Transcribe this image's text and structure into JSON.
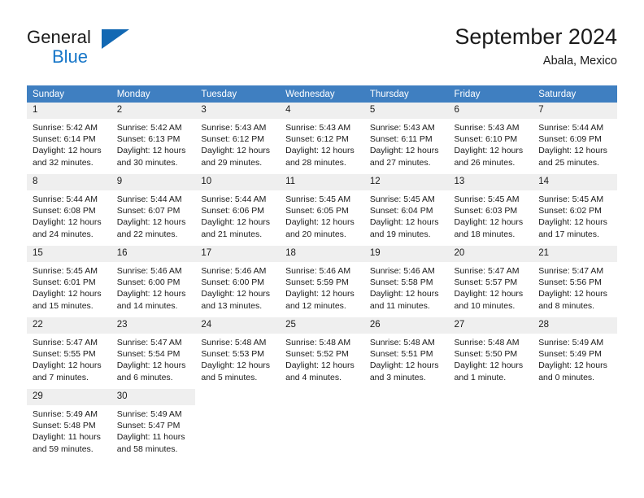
{
  "brand": {
    "name_part1": "General",
    "name_part2": "Blue",
    "logo_icon": "triangle-flag-icon"
  },
  "header": {
    "title": "September 2024",
    "subtitle": "Abala, Mexico"
  },
  "colors": {
    "header_blue": "#3f7fc1",
    "week_separator_blue": "#1b66ac",
    "daynum_band": "#efefef",
    "brand_blue": "#1676c8"
  },
  "calendar": {
    "weekday_headers": [
      "Sunday",
      "Monday",
      "Tuesday",
      "Wednesday",
      "Thursday",
      "Friday",
      "Saturday"
    ],
    "weeks": [
      [
        {
          "day": "1",
          "sunrise": "Sunrise: 5:42 AM",
          "sunset": "Sunset: 6:14 PM",
          "daylight1": "Daylight: 12 hours",
          "daylight2": "and 32 minutes."
        },
        {
          "day": "2",
          "sunrise": "Sunrise: 5:42 AM",
          "sunset": "Sunset: 6:13 PM",
          "daylight1": "Daylight: 12 hours",
          "daylight2": "and 30 minutes."
        },
        {
          "day": "3",
          "sunrise": "Sunrise: 5:43 AM",
          "sunset": "Sunset: 6:12 PM",
          "daylight1": "Daylight: 12 hours",
          "daylight2": "and 29 minutes."
        },
        {
          "day": "4",
          "sunrise": "Sunrise: 5:43 AM",
          "sunset": "Sunset: 6:12 PM",
          "daylight1": "Daylight: 12 hours",
          "daylight2": "and 28 minutes."
        },
        {
          "day": "5",
          "sunrise": "Sunrise: 5:43 AM",
          "sunset": "Sunset: 6:11 PM",
          "daylight1": "Daylight: 12 hours",
          "daylight2": "and 27 minutes."
        },
        {
          "day": "6",
          "sunrise": "Sunrise: 5:43 AM",
          "sunset": "Sunset: 6:10 PM",
          "daylight1": "Daylight: 12 hours",
          "daylight2": "and 26 minutes."
        },
        {
          "day": "7",
          "sunrise": "Sunrise: 5:44 AM",
          "sunset": "Sunset: 6:09 PM",
          "daylight1": "Daylight: 12 hours",
          "daylight2": "and 25 minutes."
        }
      ],
      [
        {
          "day": "8",
          "sunrise": "Sunrise: 5:44 AM",
          "sunset": "Sunset: 6:08 PM",
          "daylight1": "Daylight: 12 hours",
          "daylight2": "and 24 minutes."
        },
        {
          "day": "9",
          "sunrise": "Sunrise: 5:44 AM",
          "sunset": "Sunset: 6:07 PM",
          "daylight1": "Daylight: 12 hours",
          "daylight2": "and 22 minutes."
        },
        {
          "day": "10",
          "sunrise": "Sunrise: 5:44 AM",
          "sunset": "Sunset: 6:06 PM",
          "daylight1": "Daylight: 12 hours",
          "daylight2": "and 21 minutes."
        },
        {
          "day": "11",
          "sunrise": "Sunrise: 5:45 AM",
          "sunset": "Sunset: 6:05 PM",
          "daylight1": "Daylight: 12 hours",
          "daylight2": "and 20 minutes."
        },
        {
          "day": "12",
          "sunrise": "Sunrise: 5:45 AM",
          "sunset": "Sunset: 6:04 PM",
          "daylight1": "Daylight: 12 hours",
          "daylight2": "and 19 minutes."
        },
        {
          "day": "13",
          "sunrise": "Sunrise: 5:45 AM",
          "sunset": "Sunset: 6:03 PM",
          "daylight1": "Daylight: 12 hours",
          "daylight2": "and 18 minutes."
        },
        {
          "day": "14",
          "sunrise": "Sunrise: 5:45 AM",
          "sunset": "Sunset: 6:02 PM",
          "daylight1": "Daylight: 12 hours",
          "daylight2": "and 17 minutes."
        }
      ],
      [
        {
          "day": "15",
          "sunrise": "Sunrise: 5:45 AM",
          "sunset": "Sunset: 6:01 PM",
          "daylight1": "Daylight: 12 hours",
          "daylight2": "and 15 minutes."
        },
        {
          "day": "16",
          "sunrise": "Sunrise: 5:46 AM",
          "sunset": "Sunset: 6:00 PM",
          "daylight1": "Daylight: 12 hours",
          "daylight2": "and 14 minutes."
        },
        {
          "day": "17",
          "sunrise": "Sunrise: 5:46 AM",
          "sunset": "Sunset: 6:00 PM",
          "daylight1": "Daylight: 12 hours",
          "daylight2": "and 13 minutes."
        },
        {
          "day": "18",
          "sunrise": "Sunrise: 5:46 AM",
          "sunset": "Sunset: 5:59 PM",
          "daylight1": "Daylight: 12 hours",
          "daylight2": "and 12 minutes."
        },
        {
          "day": "19",
          "sunrise": "Sunrise: 5:46 AM",
          "sunset": "Sunset: 5:58 PM",
          "daylight1": "Daylight: 12 hours",
          "daylight2": "and 11 minutes."
        },
        {
          "day": "20",
          "sunrise": "Sunrise: 5:47 AM",
          "sunset": "Sunset: 5:57 PM",
          "daylight1": "Daylight: 12 hours",
          "daylight2": "and 10 minutes."
        },
        {
          "day": "21",
          "sunrise": "Sunrise: 5:47 AM",
          "sunset": "Sunset: 5:56 PM",
          "daylight1": "Daylight: 12 hours",
          "daylight2": "and 8 minutes."
        }
      ],
      [
        {
          "day": "22",
          "sunrise": "Sunrise: 5:47 AM",
          "sunset": "Sunset: 5:55 PM",
          "daylight1": "Daylight: 12 hours",
          "daylight2": "and 7 minutes."
        },
        {
          "day": "23",
          "sunrise": "Sunrise: 5:47 AM",
          "sunset": "Sunset: 5:54 PM",
          "daylight1": "Daylight: 12 hours",
          "daylight2": "and 6 minutes."
        },
        {
          "day": "24",
          "sunrise": "Sunrise: 5:48 AM",
          "sunset": "Sunset: 5:53 PM",
          "daylight1": "Daylight: 12 hours",
          "daylight2": "and 5 minutes."
        },
        {
          "day": "25",
          "sunrise": "Sunrise: 5:48 AM",
          "sunset": "Sunset: 5:52 PM",
          "daylight1": "Daylight: 12 hours",
          "daylight2": "and 4 minutes."
        },
        {
          "day": "26",
          "sunrise": "Sunrise: 5:48 AM",
          "sunset": "Sunset: 5:51 PM",
          "daylight1": "Daylight: 12 hours",
          "daylight2": "and 3 minutes."
        },
        {
          "day": "27",
          "sunrise": "Sunrise: 5:48 AM",
          "sunset": "Sunset: 5:50 PM",
          "daylight1": "Daylight: 12 hours",
          "daylight2": "and 1 minute."
        },
        {
          "day": "28",
          "sunrise": "Sunrise: 5:49 AM",
          "sunset": "Sunset: 5:49 PM",
          "daylight1": "Daylight: 12 hours",
          "daylight2": "and 0 minutes."
        }
      ],
      [
        {
          "day": "29",
          "sunrise": "Sunrise: 5:49 AM",
          "sunset": "Sunset: 5:48 PM",
          "daylight1": "Daylight: 11 hours",
          "daylight2": "and 59 minutes."
        },
        {
          "day": "30",
          "sunrise": "Sunrise: 5:49 AM",
          "sunset": "Sunset: 5:47 PM",
          "daylight1": "Daylight: 11 hours",
          "daylight2": "and 58 minutes."
        },
        {
          "day": "",
          "sunrise": "",
          "sunset": "",
          "daylight1": "",
          "daylight2": ""
        },
        {
          "day": "",
          "sunrise": "",
          "sunset": "",
          "daylight1": "",
          "daylight2": ""
        },
        {
          "day": "",
          "sunrise": "",
          "sunset": "",
          "daylight1": "",
          "daylight2": ""
        },
        {
          "day": "",
          "sunrise": "",
          "sunset": "",
          "daylight1": "",
          "daylight2": ""
        },
        {
          "day": "",
          "sunrise": "",
          "sunset": "",
          "daylight1": "",
          "daylight2": ""
        }
      ]
    ]
  }
}
